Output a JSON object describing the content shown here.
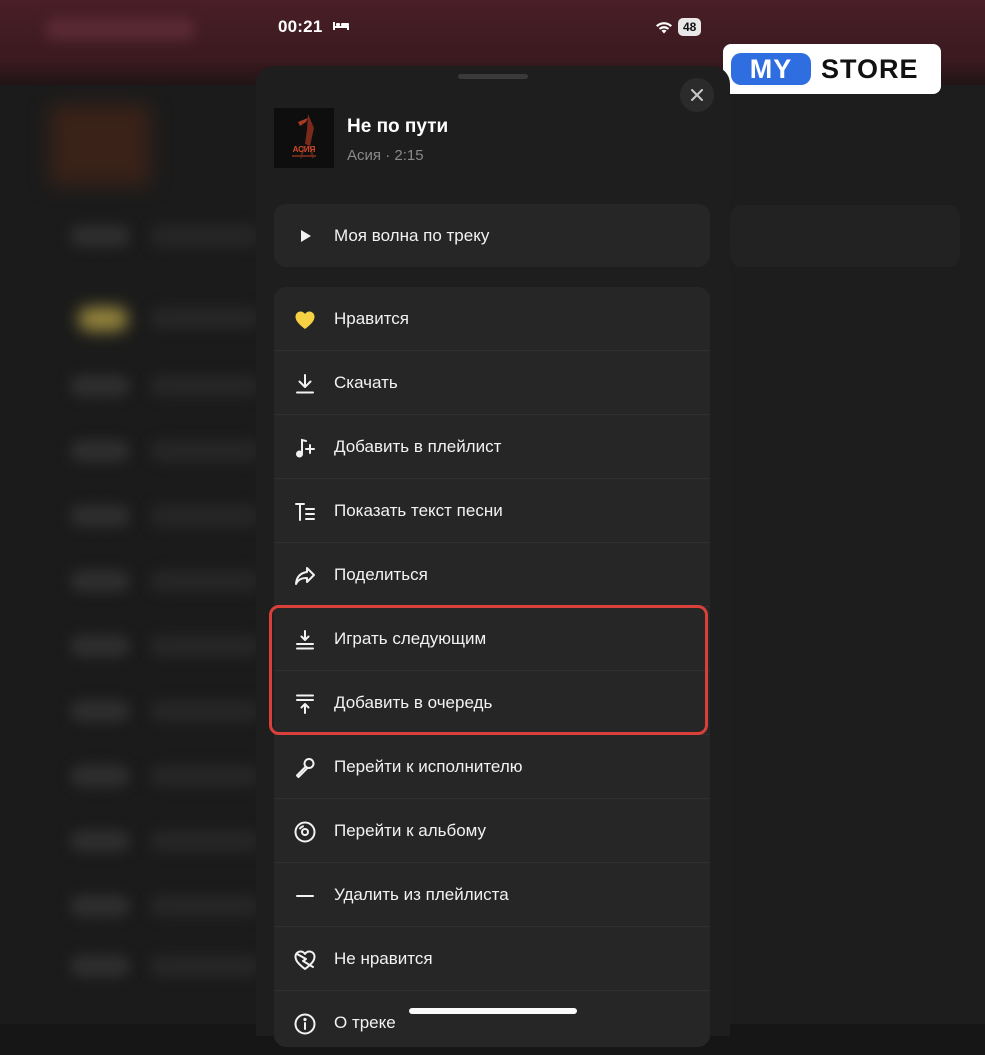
{
  "status_bar": {
    "time": "00:21",
    "battery": "48"
  },
  "logo": {
    "part1": "MY",
    "part2": "STORE"
  },
  "track": {
    "title": "Не по пути",
    "artist": "Асия",
    "separator": "·",
    "duration": "2:15",
    "cover_text": "АСИЯ"
  },
  "wave": {
    "label": "Моя волна по треку",
    "icon": "play-icon"
  },
  "menu": [
    {
      "label": "Нравится",
      "icon": "heart-icon"
    },
    {
      "label": "Скачать",
      "icon": "download-icon"
    },
    {
      "label": "Добавить в плейлист",
      "icon": "add-to-playlist-icon"
    },
    {
      "label": "Показать текст песни",
      "icon": "lyrics-icon"
    },
    {
      "label": "Поделиться",
      "icon": "share-icon"
    },
    {
      "label": "Играть следующим",
      "icon": "play-next-icon"
    },
    {
      "label": "Добавить в очередь",
      "icon": "add-to-queue-icon"
    },
    {
      "label": "Перейти к исполнителю",
      "icon": "microphone-icon"
    },
    {
      "label": "Перейти к альбому",
      "icon": "album-icon"
    },
    {
      "label": "Удалить из плейлиста",
      "icon": "minus-icon"
    },
    {
      "label": "Не нравится",
      "icon": "broken-heart-icon"
    },
    {
      "label": "О треке",
      "icon": "info-icon"
    }
  ],
  "colors": {
    "accent_yellow": "#f5d143",
    "highlight_red": "#d9403a",
    "logo_blue": "#2f6ee0"
  }
}
